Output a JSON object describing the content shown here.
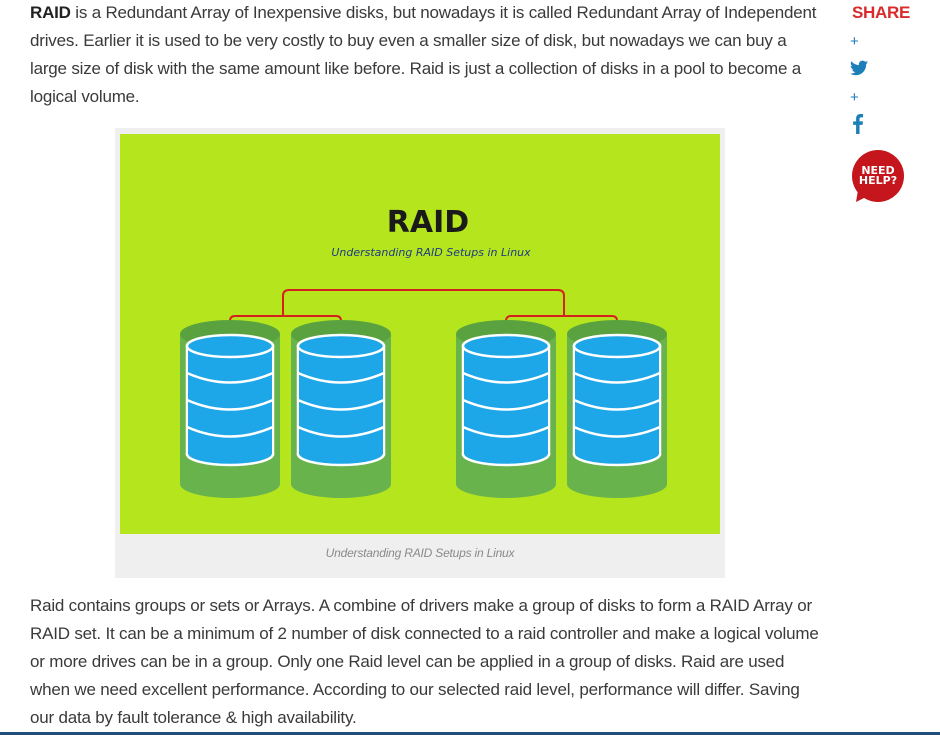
{
  "article": {
    "para1_bold": "RAID",
    "para1_rest": " is a Redundant Array of Inexpensive disks, but nowadays it is called Redundant Array of Independent drives. Earlier it is used to be very costly to buy even a smaller size of disk, but nowadays we can buy a large size of disk with the same amount like before. Raid is just a collection of disks in a pool to become a logical volume.",
    "para2": "Raid contains groups or sets or Arrays. A combine of drivers make a group of disks to form a RAID Array or RAID set. It can be a minimum of 2 number of disk connected to a raid controller and make a logical volume or more drives can be in a group. Only one Raid level can be applied in a group of disks. Raid are used when we need excellent performance. According to our selected raid level, performance will differ. Saving our data by fault tolerance & high availability."
  },
  "figure": {
    "image_title": "RAID",
    "image_subtitle": "Understanding RAID Setups in Linux",
    "caption": "Understanding RAID Setups in Linux",
    "background_color": "#b5e61d",
    "disk_color": "#1da6e8",
    "base_color": "#69b34c",
    "connector_color": "#d6201e"
  },
  "share": {
    "label": "SHARE",
    "plus_1": "+",
    "plus_2": "+",
    "twitter_icon": "twitter-icon",
    "facebook_icon": "facebook-icon",
    "need_help_line1": "NEED",
    "need_help_line2": "HELP?",
    "label_color": "#d92b2b",
    "icon_color": "#1d7fb8"
  }
}
